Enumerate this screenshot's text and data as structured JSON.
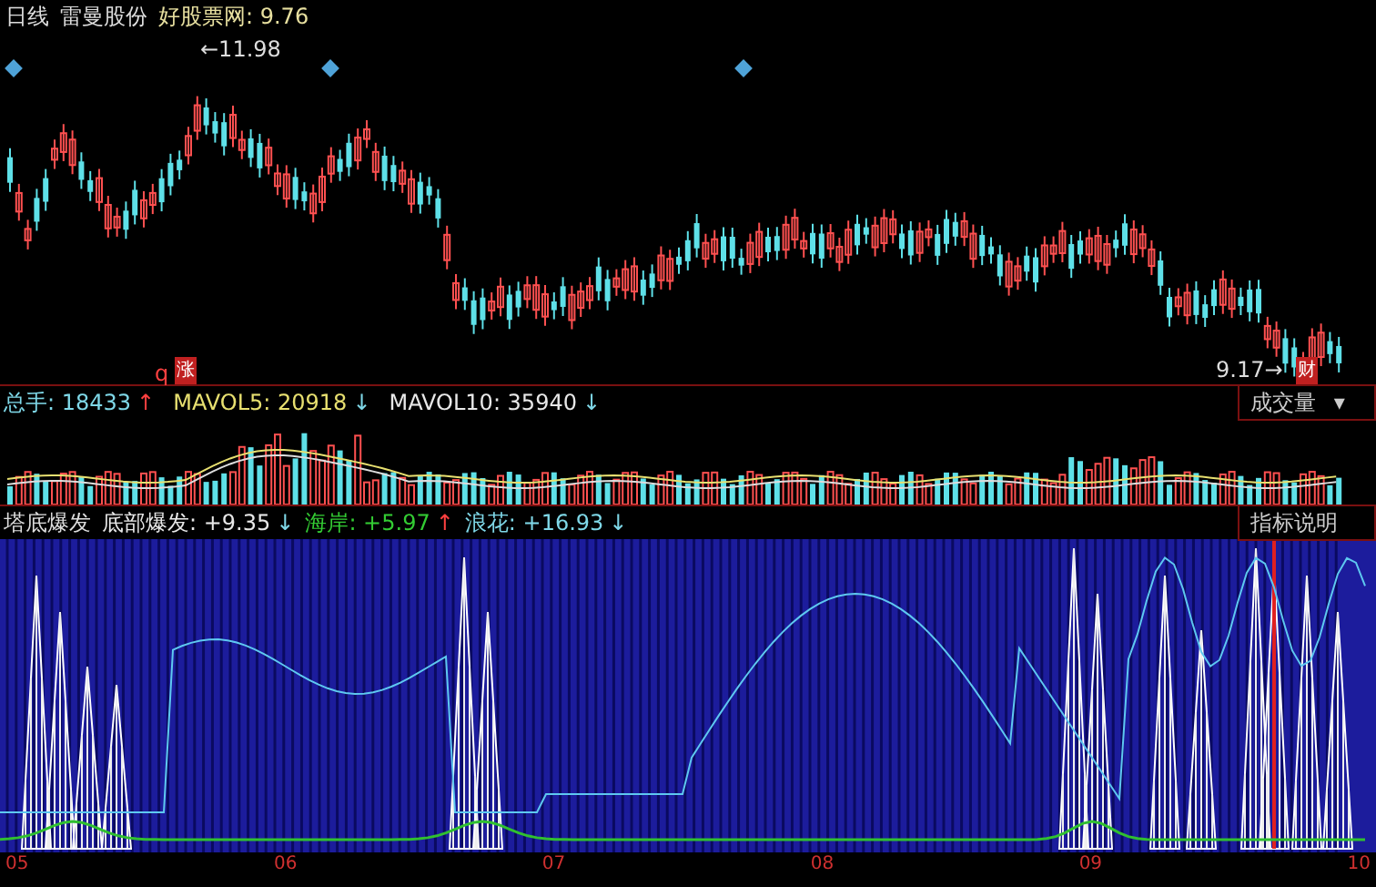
{
  "header": {
    "period": "日线",
    "stock_name": "雷曼股份",
    "source": "好股票网: 9.76"
  },
  "price_panel": {
    "high_label": "←11.98",
    "low_label": "9.17→",
    "low_badge": "财",
    "markers": [
      {
        "kind": "letter",
        "text": "q"
      },
      {
        "kind": "badge",
        "text": "涨"
      }
    ]
  },
  "volume_panel": {
    "readings": [
      {
        "label": "总手: 18433",
        "color": "#7fd8e8",
        "arrow": {
          "text": "↑",
          "color": "#ff4040"
        }
      },
      {
        "label": "MAVOL5: 20918",
        "color": "#e8e070",
        "arrow": {
          "text": "↓",
          "color": "#7fd8e8"
        }
      },
      {
        "label": "MAVOL10: 35940",
        "color": "#e8e8e8",
        "arrow": {
          "text": "↓",
          "color": "#7fd8e8"
        }
      }
    ],
    "indicator_select": {
      "label": "成交量",
      "caret": "▾"
    }
  },
  "indicator_panel": {
    "title": "塔底爆发",
    "readings": [
      {
        "label": "底部爆发: +9.35",
        "color": "#e8e8e8",
        "arrow": {
          "text": "↓",
          "color": "#7fd8e8"
        }
      },
      {
        "label": "海岸: +5.97",
        "color": "#33cc33",
        "arrow": {
          "text": "↑",
          "color": "#ff4040"
        }
      },
      {
        "label": "浪花: +16.93",
        "color": "#7fd8e8",
        "arrow": {
          "text": "↓",
          "color": "#7fd8e8"
        }
      }
    ],
    "help_button": "指标说明"
  },
  "x_axis": {
    "labels": [
      "05",
      "06",
      "07",
      "08",
      "09",
      "10"
    ]
  }
}
